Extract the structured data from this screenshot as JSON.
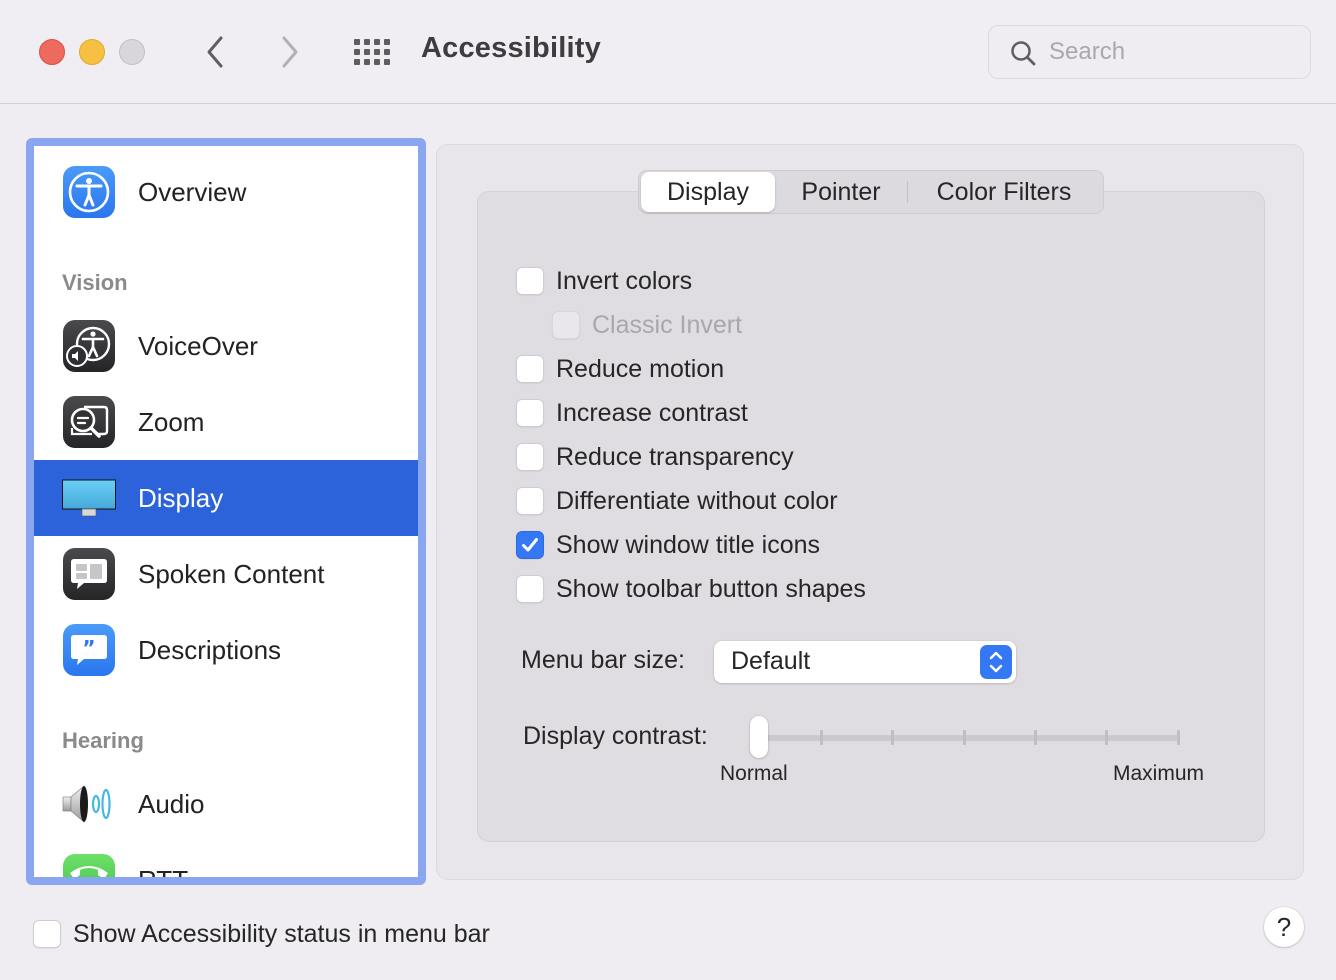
{
  "window": {
    "title": "Accessibility",
    "traffic_lights": {
      "close": "#ee6a5e",
      "minimize": "#f6c143",
      "zoom": "#d8d6da"
    },
    "nav": {
      "back_icon": "chevron-left-icon",
      "forward_icon": "chevron-right-icon",
      "show_all_icon": "grid-icon"
    },
    "search": {
      "placeholder": "Search",
      "value": "",
      "icon": "search-icon"
    }
  },
  "sidebar": {
    "items": [
      {
        "label": "Overview",
        "icon": "accessibility-overview-icon",
        "selected": false
      },
      {
        "section": "Vision"
      },
      {
        "label": "VoiceOver",
        "icon": "voiceover-icon",
        "selected": false
      },
      {
        "label": "Zoom",
        "icon": "zoom-magnifier-icon",
        "selected": false
      },
      {
        "label": "Display",
        "icon": "display-monitor-icon",
        "selected": true
      },
      {
        "label": "Spoken Content",
        "icon": "spoken-content-icon",
        "selected": false
      },
      {
        "label": "Descriptions",
        "icon": "descriptions-quote-icon",
        "selected": false
      },
      {
        "section": "Hearing"
      },
      {
        "label": "Audio",
        "icon": "speaker-icon",
        "selected": false
      },
      {
        "label": "RTT",
        "icon": "rtt-phone-icon",
        "selected": false
      }
    ],
    "selection_color": "#2c62da",
    "focus_ring_color": "#8aa6ee"
  },
  "tabs": [
    {
      "label": "Display",
      "active": true
    },
    {
      "label": "Pointer",
      "active": false
    },
    {
      "label": "Color Filters",
      "active": false
    }
  ],
  "options": [
    {
      "label": "Invert colors",
      "checked": false,
      "disabled": false,
      "indent": false
    },
    {
      "label": "Classic Invert",
      "checked": false,
      "disabled": true,
      "indent": true
    },
    {
      "label": "Reduce motion",
      "checked": false,
      "disabled": false,
      "indent": false
    },
    {
      "label": "Increase contrast",
      "checked": false,
      "disabled": false,
      "indent": false
    },
    {
      "label": "Reduce transparency",
      "checked": false,
      "disabled": false,
      "indent": false
    },
    {
      "label": "Differentiate without color",
      "checked": false,
      "disabled": false,
      "indent": false
    },
    {
      "label": "Show window title icons",
      "checked": true,
      "disabled": false,
      "indent": false
    },
    {
      "label": "Show toolbar button shapes",
      "checked": false,
      "disabled": false,
      "indent": false
    }
  ],
  "menu_bar_size": {
    "label": "Menu bar size:",
    "value": "Default"
  },
  "display_contrast": {
    "label": "Display contrast:",
    "min_label": "Normal",
    "max_label": "Maximum",
    "value": 0,
    "ticks": 7
  },
  "footer": {
    "status_checkbox": {
      "label": "Show Accessibility status in menu bar",
      "checked": false
    },
    "help_label": "?"
  },
  "accent_color": "#3478f6"
}
